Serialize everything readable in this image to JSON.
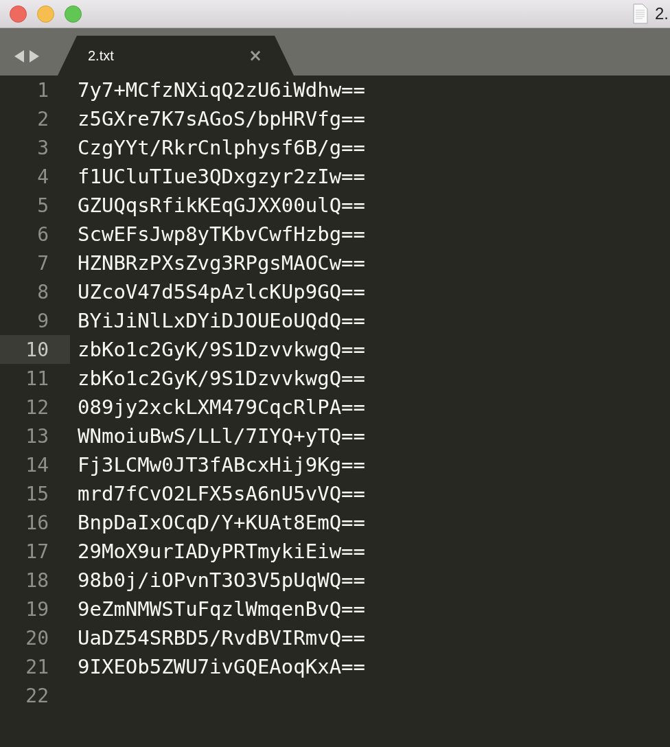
{
  "window": {
    "title": "2."
  },
  "tabs": [
    {
      "label": "2.txt",
      "selected": true,
      "close": "×"
    }
  ],
  "editor": {
    "lines": [
      {
        "number": "1",
        "text": "7y7+MCfzNXiqQ2zU6iWdhw==",
        "current": false
      },
      {
        "number": "2",
        "text": "z5GXre7K7sAGoS/bpHRVfg==",
        "current": false
      },
      {
        "number": "3",
        "text": "CzgYYt/RkrCnlphysf6B/g==",
        "current": false
      },
      {
        "number": "4",
        "text": "f1UCluTIue3QDxgzyr2zIw==",
        "current": false
      },
      {
        "number": "5",
        "text": "GZUQqsRfikKEqGJXX00ulQ==",
        "current": false
      },
      {
        "number": "6",
        "text": "ScwEFsJwp8yTKbvCwfHzbg==",
        "current": false
      },
      {
        "number": "7",
        "text": "HZNBRzPXsZvg3RPgsMAOCw==",
        "current": false
      },
      {
        "number": "8",
        "text": "UZcoV47d5S4pAzlcKUp9GQ==",
        "current": false
      },
      {
        "number": "9",
        "text": "BYiJiNlLxDYiDJOUEoUQdQ==",
        "current": false
      },
      {
        "number": "10",
        "text": "zbKo1c2GyK/9S1DzvvkwgQ==",
        "current": true
      },
      {
        "number": "11",
        "text": "zbKo1c2GyK/9S1DzvvkwgQ==",
        "current": false
      },
      {
        "number": "12",
        "text": "089jy2xckLXM479CqcRlPA==",
        "current": false
      },
      {
        "number": "13",
        "text": "WNmoiuBwS/LLl/7IYQ+yTQ==",
        "current": false
      },
      {
        "number": "14",
        "text": "Fj3LCMw0JT3fABcxHij9Kg==",
        "current": false
      },
      {
        "number": "15",
        "text": "mrd7fCvO2LFX5sA6nU5vVQ==",
        "current": false
      },
      {
        "number": "16",
        "text": "BnpDaIxOCqD/Y+KUAt8EmQ==",
        "current": false
      },
      {
        "number": "17",
        "text": "29MoX9urIADyPRTmykiEiw==",
        "current": false
      },
      {
        "number": "18",
        "text": "98b0j/iOPvnT3O3V5pUqWQ==",
        "current": false
      },
      {
        "number": "19",
        "text": "9eZmNMWSTuFqzlWmqenBvQ==",
        "current": false
      },
      {
        "number": "20",
        "text": "UaDZ54SRBD5/RvdBVIRmvQ==",
        "current": false
      },
      {
        "number": "21",
        "text": "9IXEOb5ZWU7ivGQEAoqKxA==",
        "current": false
      },
      {
        "number": "22",
        "current": false
      }
    ]
  }
}
